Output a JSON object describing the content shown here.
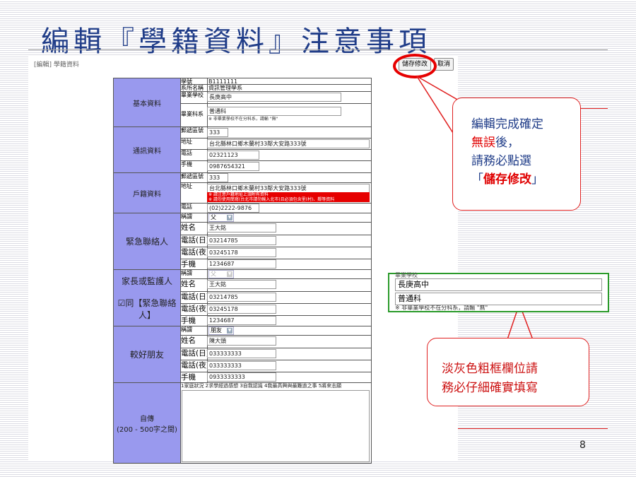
{
  "slide": {
    "title": "編輯『學籍資料』注意事項",
    "page_number": "8"
  },
  "screen": {
    "breadcrumb": "[編輯] 學籍資料",
    "save_label": "儲存修改",
    "cancel_label": "取消"
  },
  "basic": {
    "section": "基本資料",
    "student_id_label": "學號",
    "student_id": "B1111111",
    "dept_label": "系所名稱",
    "dept": "資訊管理學系",
    "school_label": "畢業學校",
    "school": "長庚高中",
    "track_label": "畢業科系",
    "track": "普通科",
    "track_note": "※ 非畢業學校不在分科系，請輸 \"無\""
  },
  "contact": {
    "section": "通訊資料",
    "zip_label": "郵遞區號",
    "zip": "333",
    "addr_label": "地址",
    "addr": "台北縣林口鄉木蘭村33鄰大安路333號",
    "phone_label": "電話",
    "phone": "02321123",
    "mobile_label": "手機",
    "mobile": "0987654321"
  },
  "household": {
    "section": "戶籍資料",
    "zip_label": "郵遞區號",
    "zip": "333",
    "addr_label": "地址",
    "addr": "台北縣林口鄉木蘭村33鄰大安路333號",
    "warning1": "※ 請注意戶籍地址上須附有資料",
    "warning2": "※ 請勿使用簡寫(台北市請勿輸入北市)且必須包含里(村)、鄰等資料",
    "phone_label": "電話",
    "phone": "(02)2222-9876"
  },
  "emergency": {
    "section": "緊急聯絡人",
    "rel_label": "稱謂",
    "rel": "父",
    "name_label": "姓名",
    "name": "王大銘",
    "day_label": "電話(日)",
    "day": "03214785",
    "night_label": "電話(夜)",
    "night": "03245178",
    "mobile_label": "手機",
    "mobile": "1234687"
  },
  "guardian": {
    "section": "家長或監護人",
    "same_label": "☑同【緊急聯絡人】",
    "rel_label": "稱謂",
    "rel": "父",
    "name_label": "姓名",
    "name": "王大銘",
    "day_label": "電話(日)",
    "day": "03214785",
    "night_label": "電話(夜)",
    "night": "03245178",
    "mobile_label": "手機",
    "mobile": "1234687"
  },
  "friend": {
    "section": "較好朋友",
    "rel_label": "稱謂",
    "rel": "朋友",
    "name_label": "姓名",
    "name": "陳大頭",
    "day_label": "電話(日)",
    "day": "033333333",
    "night_label": "電話(夜)",
    "night": "033333333",
    "mobile_label": "手機",
    "mobile": "0933333333"
  },
  "autobio": {
    "section": "自傳",
    "range": "(200 - 500字之間)",
    "prompt": "1家庭狀況 2求學經過感想 3自我認識 4我最高興與最難過之事 5將來志願"
  },
  "callout1": {
    "line1": "編輯完成確定",
    "line2a": "無誤",
    "line2b": "後，",
    "line3": "請務必點選",
    "line4_open": "「",
    "line4_key": "儲存修改",
    "line4_close": "」"
  },
  "zoom": {
    "school": "長庚高中",
    "track": "普通科",
    "cut_top": "畢業學校",
    "cut_bottom": "※ 非畢業學校不在分科系，請輸 \"無\""
  },
  "callout2": {
    "line1": "淡灰色粗框欄位請",
    "line2": "務必仔細確實填寫"
  },
  "colors": {
    "title": "#1f3c88",
    "section_bg": "#9999ee",
    "callout_border": "#e02020",
    "zoom_border": "#2a9a2a",
    "warning_bg": "#e60000"
  }
}
